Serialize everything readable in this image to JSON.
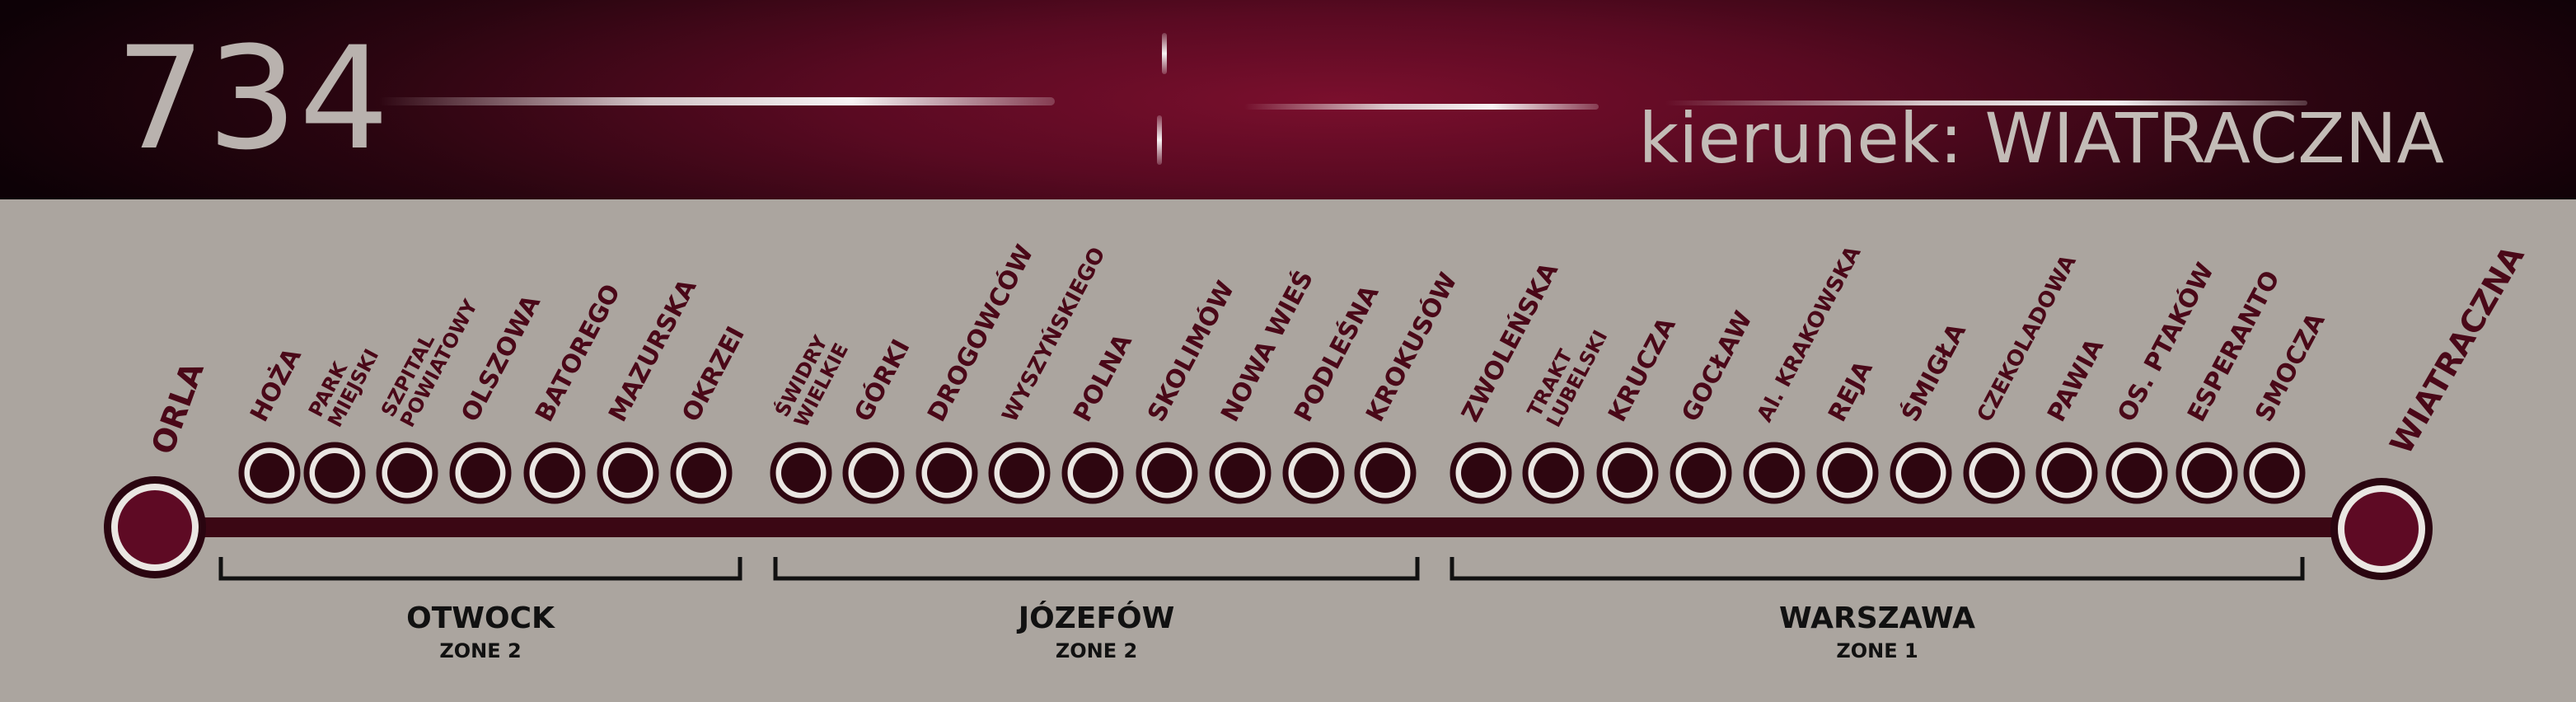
{
  "route": {
    "number": "734",
    "direction": "kierunek: WIATRACZNA"
  },
  "colors": {
    "line": "#3b0714",
    "terminal_fill": "#5e0a24",
    "stop_fill": "#2e0610",
    "ring": "#eae6e2",
    "label": "#4a0818",
    "zone_text": "#111111",
    "background": "#aba59f",
    "header": "#5a0a22"
  },
  "start_terminal": "ORLA",
  "end_terminal": "WIATRACZNA",
  "stops": [
    {
      "name": "HOŻA",
      "lines": [
        "HOŻA"
      ]
    },
    {
      "name": "PARK MIEJSKI",
      "lines": [
        "PARK",
        "MIEJSKI"
      ]
    },
    {
      "name": "SZPITAL POWIATOWY",
      "lines": [
        "SZPITAL",
        "POWIATOWY"
      ]
    },
    {
      "name": "OLSZOWA",
      "lines": [
        "OLSZOWA"
      ]
    },
    {
      "name": "BATOREGO",
      "lines": [
        "BATOREGO"
      ]
    },
    {
      "name": "MAZURSKA",
      "lines": [
        "MAZURSKA"
      ]
    },
    {
      "name": "OKRZEI",
      "lines": [
        "OKRZEI"
      ]
    },
    {
      "name": "ŚWIDRY WIELKIE",
      "lines": [
        "ŚWIDRY",
        "WIELKIE"
      ]
    },
    {
      "name": "GÓRKI",
      "lines": [
        "GÓRKI"
      ]
    },
    {
      "name": "DROGOWCÓW",
      "lines": [
        "DROGOWCÓW"
      ]
    },
    {
      "name": "WYSZYŃSKIEGO",
      "lines": [
        "WYSZYŃSKIEGO"
      ]
    },
    {
      "name": "POLNA",
      "lines": [
        "POLNA"
      ]
    },
    {
      "name": "SKOLIMÓW",
      "lines": [
        "SKOLIMÓW"
      ]
    },
    {
      "name": "NOWA WIEŚ",
      "lines": [
        "NOWA WIEŚ"
      ]
    },
    {
      "name": "PODLEŚNA",
      "lines": [
        "PODLEŚNA"
      ]
    },
    {
      "name": "KROKUSÓW",
      "lines": [
        "KROKUSÓW"
      ]
    },
    {
      "name": "ZWOLEŃSKA",
      "lines": [
        "ZWOLEŃSKA"
      ]
    },
    {
      "name": "TRAKT LUBELSKI",
      "lines": [
        "TRAKT",
        "LUBELSKI"
      ]
    },
    {
      "name": "KRUCZA",
      "lines": [
        "KRUCZA"
      ]
    },
    {
      "name": "GOCŁAW",
      "lines": [
        "GOCŁAW"
      ]
    },
    {
      "name": "Al. KRAKOWSKA",
      "lines": [
        "Al. KRAKOWSKA"
      ]
    },
    {
      "name": "REJA",
      "lines": [
        "REJA"
      ]
    },
    {
      "name": "ŚMIGŁA",
      "lines": [
        "ŚMIGŁA"
      ]
    },
    {
      "name": "CZEKOLADOWA",
      "lines": [
        "CZEKOLADOWA"
      ]
    },
    {
      "name": "PAWIA",
      "lines": [
        "PAWIA"
      ]
    },
    {
      "name": "OS. PTAKÓW",
      "lines": [
        "OS. PTAKÓW"
      ]
    },
    {
      "name": "ESPERANTO",
      "lines": [
        "ESPERANTO"
      ]
    },
    {
      "name": "SMOCZA",
      "lines": [
        "SMOCZA"
      ]
    }
  ],
  "zones": [
    {
      "name": "OTWOCK",
      "zone": "ZONE 2"
    },
    {
      "name": "JÓZEFÓW",
      "zone": "ZONE 2"
    },
    {
      "name": "WARSZAWA",
      "zone": "ZONE 1"
    }
  ]
}
